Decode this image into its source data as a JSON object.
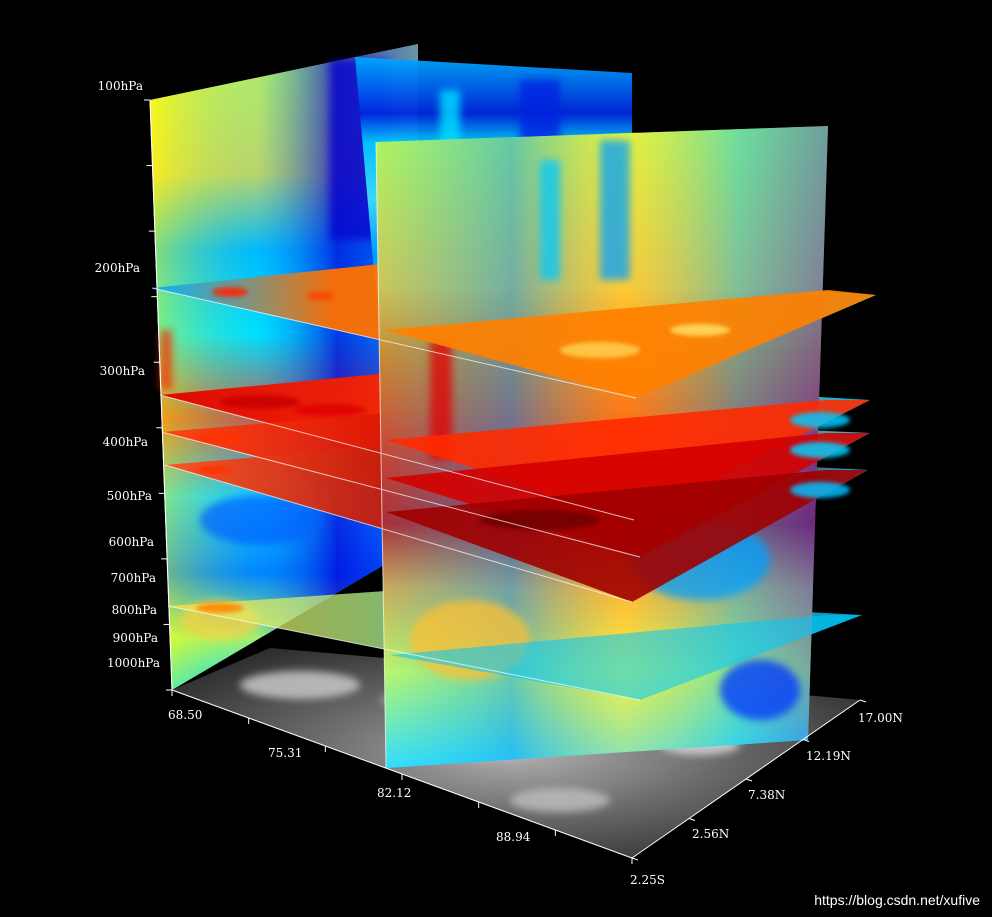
{
  "pressure_levels": [
    "100hPa",
    "200hPa",
    "300hPa",
    "400hPa",
    "500hPa",
    "600hPa",
    "700hPa",
    "800hPa",
    "900hPa",
    "1000hPa"
  ],
  "longitude_ticks": [
    "68.50",
    "75.31",
    "82.12",
    "88.94"
  ],
  "latitude_ticks": [
    "2.25S",
    "2.56N",
    "7.38N",
    "12.19N",
    "17.00N"
  ],
  "watermark": "https://blog.csdn.net/xufive",
  "colors": {
    "background": "#000000",
    "jet_dark_blue": "#0000c8",
    "jet_blue": "#0078ff",
    "jet_cyan": "#00e6ff",
    "jet_yellow": "#e6ff3c",
    "jet_orange": "#ff8c00",
    "jet_red": "#e60000",
    "jet_dark_red": "#960000",
    "cloud_gray": "#8a8a8a"
  }
}
